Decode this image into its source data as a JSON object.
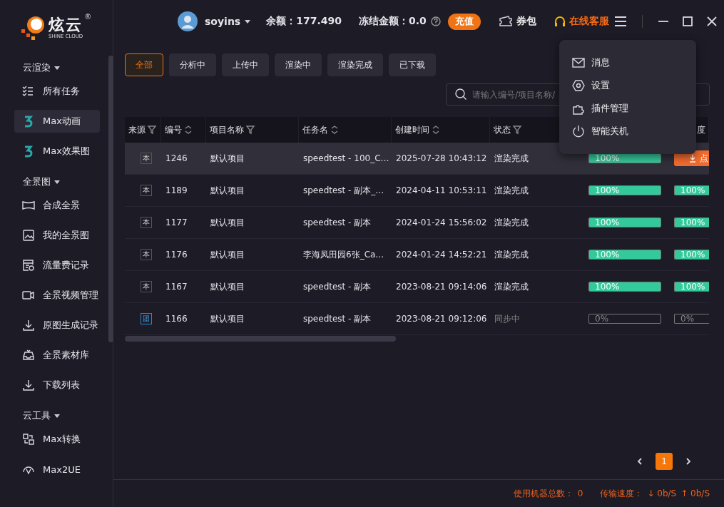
{
  "logo": {
    "name": "炫云",
    "tagline": "SHINE CLOUD",
    "mark": "®"
  },
  "sidebar": {
    "groups": [
      {
        "title": "云渲染",
        "items": [
          {
            "label": "所有任务",
            "selected": false
          },
          {
            "label": "Max动画",
            "selected": true
          },
          {
            "label": "Max效果图",
            "selected": false
          }
        ]
      },
      {
        "title": "全景图",
        "items": [
          {
            "label": "合成全景",
            "selected": false
          },
          {
            "label": "我的全景图",
            "selected": false
          },
          {
            "label": "流量费记录",
            "selected": false
          },
          {
            "label": "全景视频管理",
            "selected": false
          },
          {
            "label": "原图生成记录",
            "selected": false
          },
          {
            "label": "全景素材库",
            "selected": false
          },
          {
            "label": "下载列表",
            "selected": false
          }
        ]
      },
      {
        "title": "云工具",
        "items": [
          {
            "label": "Max转换",
            "selected": false
          },
          {
            "label": "Max2UE",
            "selected": false
          }
        ]
      }
    ]
  },
  "header": {
    "user": "soyins",
    "balance": "余额：177.490",
    "frozen": "冻结金额：0.0",
    "recharge": "充值",
    "wallet": "券包",
    "support": "在线客服"
  },
  "filters": [
    {
      "label": "全部",
      "selected": true
    },
    {
      "label": "分析中",
      "selected": false
    },
    {
      "label": "上传中",
      "selected": false
    },
    {
      "label": "渲染中",
      "selected": false
    },
    {
      "label": "渲染完成",
      "selected": false
    },
    {
      "label": "已下载",
      "selected": false
    }
  ],
  "search": {
    "placeholder": "请输入编号/项目名称/"
  },
  "table": {
    "columns": [
      {
        "label": "来源",
        "kind": "filter"
      },
      {
        "label": "编号",
        "kind": "sort"
      },
      {
        "label": "项目名称",
        "kind": "filter"
      },
      {
        "label": "任务名",
        "kind": "sort"
      },
      {
        "label": "创建时间",
        "kind": "sort"
      },
      {
        "label": "状态",
        "kind": "filter"
      },
      {
        "label": "度",
        "kind": "plain"
      }
    ],
    "rows": [
      {
        "selected": true,
        "source": {
          "text": "本",
          "kind": "local"
        },
        "id": "1246",
        "project": "默认项目",
        "task": "speedtest - 100_C…",
        "created": "2025-07-28 10:43:12",
        "status": "渲染完成",
        "pending": false,
        "progress": {
          "level": 1,
          "text": "100%"
        },
        "column_8": {
          "kind": "button",
          "text": "点"
        }
      },
      {
        "selected": false,
        "source": {
          "text": "本",
          "kind": "local"
        },
        "id": "1189",
        "project": "默认项目",
        "task": "speedtest - 副本_…",
        "created": "2024-04-11 10:53:11",
        "status": "渲染完成",
        "pending": false,
        "progress": {
          "level": 1,
          "text": "100%"
        },
        "column_8": {
          "kind": "progress",
          "level": 1,
          "text": "100%"
        }
      },
      {
        "selected": false,
        "source": {
          "text": "本",
          "kind": "local"
        },
        "id": "1177",
        "project": "默认项目",
        "task": "speedtest - 副本",
        "created": "2024-01-24 15:56:02",
        "status": "渲染完成",
        "pending": false,
        "progress": {
          "level": 1,
          "text": "100%"
        },
        "column_8": {
          "kind": "progress",
          "level": 1,
          "text": "100%"
        }
      },
      {
        "selected": false,
        "source": {
          "text": "本",
          "kind": "local"
        },
        "id": "1176",
        "project": "默认项目",
        "task": "李海凤田园6张_Ca…",
        "created": "2024-01-24 14:52:21",
        "status": "渲染完成",
        "pending": false,
        "progress": {
          "level": 1,
          "text": "100%"
        },
        "column_8": {
          "kind": "progress",
          "level": 1,
          "text": "100%"
        }
      },
      {
        "selected": false,
        "source": {
          "text": "本",
          "kind": "local"
        },
        "id": "1167",
        "project": "默认项目",
        "task": "speedtest - 副本",
        "created": "2023-08-21 09:14:06",
        "status": "渲染完成",
        "pending": false,
        "progress": {
          "level": 1,
          "text": "100%"
        },
        "column_8": {
          "kind": "progress",
          "level": 1,
          "text": "100%"
        }
      },
      {
        "selected": false,
        "source": {
          "text": "团",
          "kind": "team"
        },
        "id": "1166",
        "project": "默认项目",
        "task": "speedtest - 副本",
        "created": "2023-08-21 09:12:06",
        "status": "同步中",
        "pending": true,
        "progress": {
          "level": 0,
          "text": "0%"
        },
        "column_8": {
          "kind": "progress",
          "level": 0,
          "text": "0%"
        }
      }
    ]
  },
  "pagination": {
    "pages": [
      {
        "label": "1",
        "selected": true
      }
    ]
  },
  "menu": {
    "items": [
      {
        "label": "消息"
      },
      {
        "label": "设置"
      },
      {
        "label": "插件管理"
      },
      {
        "label": "智能关机"
      }
    ]
  },
  "status_bar": {
    "machines_label": "使用机器总数：",
    "machines": "0",
    "speed_label": "传输速度：",
    "down": "↓ 0b/S",
    "up": "↑ 0b/S"
  }
}
